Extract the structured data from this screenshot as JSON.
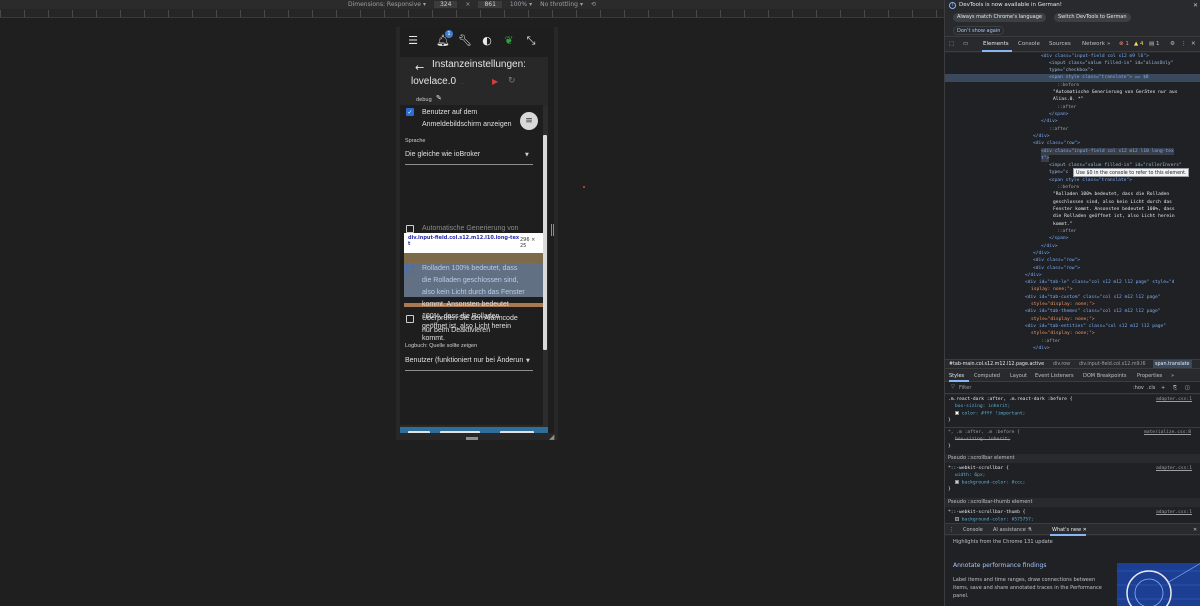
{
  "device_toolbar": {
    "dimensions_label": "Dimensions: Responsive",
    "width": "324",
    "times": "×",
    "height": "861",
    "zoom": "100%",
    "throttle": "No throttling"
  },
  "app": {
    "notification_count": "1",
    "dialog": {
      "title_line1": "Instanzeinstellungen:",
      "title_line2": "lovelace.0",
      "faint_text": "...",
      "debug_label": "debug",
      "checkbox1_line1": "Benutzer auf dem",
      "checkbox1_line2": "Anmeldebildschirm anzeigen",
      "language_label": "Sprache",
      "language_value": "Die gleiche wie ioBroker",
      "hidden_row_text": "Automatische Generierung von",
      "tooltip_selector_line1": "div.input-field.col.s12.m12.l10.long-tex",
      "tooltip_selector_line2": "t",
      "tooltip_size": "296 × 25",
      "roll_line1": "Rolladen 100% bedeutet, dass",
      "roll_line2": "die Rolladen geschlossen sind,",
      "roll_line3": "also kein Licht durch das Fenster",
      "roll_line4": "kommt. Ansonsten bedeutet",
      "roll_line5": "100%, dass die Rolladen",
      "roll_line6": "geöffnet ist, also Licht herein",
      "roll_line7": "kommt.",
      "alarm_line1": "Überprüfen Sie den Alarmcode",
      "alarm_line2": "nur beim Deaktivieren",
      "logbook_label": "Logbuch: Quelle sollte zeigen",
      "logbook_value": "Benutzer (funktioniert nur bei Änderun"
    }
  },
  "devtools": {
    "info": {
      "title": "DevTools is now available in German!",
      "btn_match": "Always match Chrome's language",
      "btn_switch": "Switch DevTools to German",
      "dont_show": "Don't show again"
    },
    "tabs": [
      "Elements",
      "Console",
      "Sources",
      "Network"
    ],
    "badges": {
      "errors": "1",
      "warnings": "4",
      "info": "1"
    },
    "tree": {
      "l1": "<div class=\"input-field col s12 m9 l6\">",
      "l2": "<input class=\"value filled-in\" id=\"aliasOnly\"",
      "l3": "type=\"checkbox\">",
      "l4": "<span style class=\"translate\"> == $0",
      "l5": "::before",
      "l6": "\"Automatische Generierung von Geräten nur aus",
      "l7": "Alias.0. *\"",
      "l8": "::after",
      "l9": "</span>",
      "l10": "</div>",
      "l11": "::after",
      "l12": "</div>",
      "l13": "<div class=\"row\">",
      "l14": "<div class=\"input-field col s12 m12 l10 long-tex",
      "l15": "t\">",
      "l16": "<input class=\"value filled-in\" id=\"rollerInvers\"",
      "l17": "type=\"c",
      "l18": "<span style class=\"translate\">",
      "l19": "::before",
      "l20": "\"Rolladen 100% bedeutet, dass die Rolladen",
      "l21": "geschlossen sind, also kein Licht durch das",
      "l22": "Fenster kommt. Ansonsten bedeutet 100%, dass",
      "l23": "die Rolladen geöffnet ist, also Licht herein",
      "l24": "kommt.\"",
      "l25": "::after",
      "l26": "</span>",
      "l27": "</div>",
      "l28": "</div>",
      "l29": "<div class=\"row\">",
      "l30": "<div class=\"row\">",
      "l31": "</div>",
      "l32": "<div id=\"tab-le\" class=\"col s12 m12 l12 page\" style=\"d",
      "l33": "isplay: none;\">",
      "l34": "<div id=\"tab-custom\" class=\"col s12 m12 l12 page\"",
      "l35": "style=\"display: none;\">",
      "l36": "<div id=\"tab-themes\" class=\"col s12 m12 l12 page\"",
      "l37": "style=\"display: none;\">",
      "l38": "<div id=\"tab-entities\" class=\"col s12 m12 l12 page\"",
      "l39": "style=\"display: none;\">",
      "l40": "::after",
      "l41": "</div>"
    },
    "hover_tip": "Use $0 in the console to refer to this element.",
    "crumbs": {
      "c1": "#tab-main.col.s12.m12.l12.page.active",
      "c2": "div.row",
      "c3": "div.input-field.col.s12.m9.l6",
      "c4": "span.translate"
    },
    "style_tabs": [
      "Styles",
      "Computed",
      "Layout",
      "Event Listeners",
      "DOM Breakpoints",
      "Properties"
    ],
    "style_tabs_more": "»",
    "filter_placeholder": "Filter",
    "filter_hov": ":hov",
    "filter_cls": ".cls",
    "styles": {
      "r1_sel": ".m.react-dark :after, .m.react-dark :before {",
      "r1_src": "adapter.css:1",
      "r1_p1": "box-sizing: inherit;",
      "r1_p2": "color: #fff !important;",
      "r1_close": "}",
      "r2_sel": "*, .m :after, .m :before {",
      "r2_src": "materialize.css:8",
      "r2_p1": "box-sizing: inherit;",
      "r2_close": "}",
      "pseudo1": "Pseudo ::scrollbar element",
      "r3_sel": "*::-webkit-scrollbar {",
      "r3_src": "adapter.css:1",
      "r3_p1": "width: 6px;",
      "r3_p2": "background-color: #ccc;",
      "r3_close": "}",
      "pseudo2": "Pseudo ::scrollbar-thumb element",
      "r4_sel": "*::-webkit-scrollbar-thumb {",
      "r4_src": "adapter.css:1",
      "r4_p1": "background-color: #575757;"
    },
    "drawer": {
      "console": "Console",
      "ai": "AI assistance",
      "whats_new": "What's new",
      "header": "Highlights from the Chrome 131 update",
      "title": "Annotate performance findings",
      "body": "Label items and time ranges, draw connections between items, save and share annotated traces in the Performance panel."
    }
  }
}
